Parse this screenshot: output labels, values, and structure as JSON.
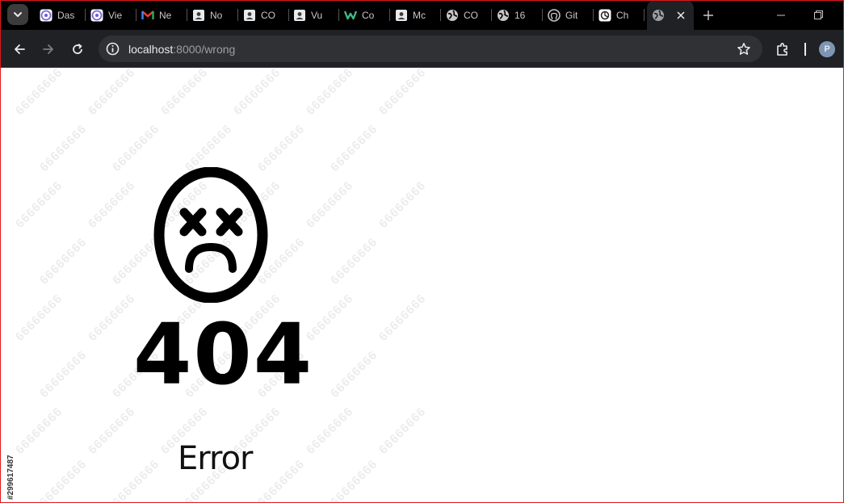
{
  "tabs": [
    {
      "label": "Das",
      "icon": "app-icon-purple"
    },
    {
      "label": "Vie",
      "icon": "app-icon-purple"
    },
    {
      "label": "Ne",
      "icon": "gmail-icon"
    },
    {
      "label": "No",
      "icon": "profile-card-icon"
    },
    {
      "label": "CO",
      "icon": "profile-card-icon"
    },
    {
      "label": "Vu",
      "icon": "profile-card-icon"
    },
    {
      "label": "Co",
      "icon": "vue-icon"
    },
    {
      "label": "Mc",
      "icon": "profile-card-icon"
    },
    {
      "label": "CO",
      "icon": "globe-icon"
    },
    {
      "label": "16",
      "icon": "globe-icon"
    },
    {
      "label": "Git",
      "icon": "github-icon"
    },
    {
      "label": "Ch",
      "icon": "chatgpt-icon"
    }
  ],
  "active_tab": {
    "label": "",
    "icon": "globe-icon"
  },
  "address": {
    "host": "localhost",
    "rest": ":8000/wrong"
  },
  "profile": {
    "initial": "P"
  },
  "page": {
    "code": "404",
    "message": "Error",
    "watermark_text": "66666666",
    "stock_id": "#299617487"
  },
  "colors": {
    "frame": "#e0191f",
    "chrome_bg": "#000000",
    "toolbar_bg": "#202124"
  }
}
